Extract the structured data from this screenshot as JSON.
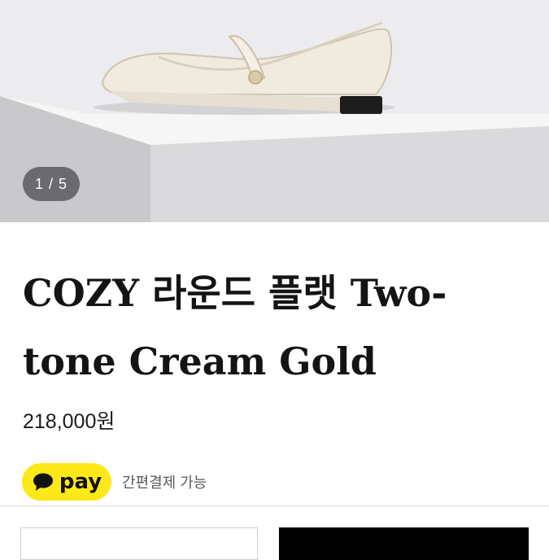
{
  "product": {
    "image_alt": "Cream mary jane flat shoe on white display block",
    "image_counter": "1 / 5",
    "title": "COZY 라운드 플랫 Two-tone Cream Gold",
    "price": "218,000원"
  },
  "payment": {
    "badge_label": "pay",
    "badge_icon": "speech-bubble-icon",
    "description": "간편결제 가능"
  },
  "colors": {
    "pay_badge": "#fde81a",
    "buy_button": "#000000",
    "shoe": "#efe8dc"
  }
}
